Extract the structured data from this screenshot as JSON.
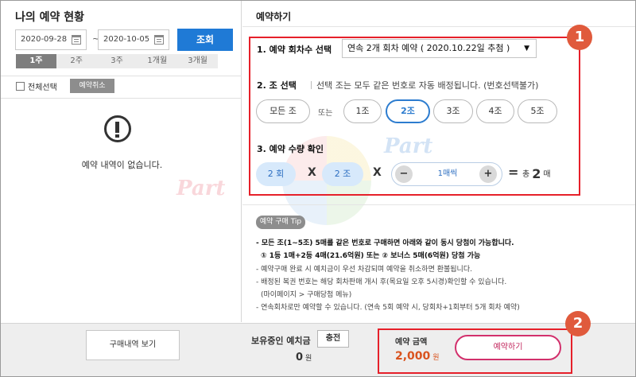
{
  "left_panel": {
    "title": "나의 예약 현황",
    "date_from": "2020-09-28",
    "date_to": "2020-10-05",
    "date_sep": "~",
    "query_btn": "조회",
    "period_tabs": [
      "1주",
      "2주",
      "3주",
      "1개월",
      "3개월"
    ],
    "active_period": "1주",
    "select_all": "전체선택",
    "cancel_btn": "예약취소",
    "empty_msg": "예약 내역이 없습니다."
  },
  "right_panel": {
    "title": "예약하기",
    "step1_label": "1. 예약 회차수 선택",
    "round_select_value": "연속 2개 회차 예약 ( 2020.10.22일 추첨 )",
    "step2_label": "2. 조 선택",
    "step2_desc": "선택 조는 모두 같은 번호로 자동 배정됩니다. (번호선택불가)",
    "all_jo": "모든 조",
    "or": "또는",
    "jo_options": [
      "1조",
      "2조",
      "3조",
      "4조",
      "5조"
    ],
    "selected_jo": "2조",
    "step3_label": "3. 예약 수량 확인",
    "rounds_pill": "2 회",
    "jo_pill": "2 조",
    "x_sign": "X",
    "minus": "−",
    "plus": "+",
    "per_qty": "1매씩",
    "equals": "=",
    "total_prefix": "총",
    "total_num": "2",
    "total_unit": "매"
  },
  "tip": {
    "tag": "예약 구매 Tip",
    "lines": [
      "- 모든 조(1~5조) 5매를 같은 번호로 구매하면 아래와 같이 동시 당첨이 가능합니다.",
      "① 1등 1매+2등 4매(21.6억원) 또는 ② 보너스 5매(6억원) 당첨 가능",
      "- 예약구매 완료 시 예치금이 우선 차감되며 예약을 취소하면 환불됩니다.",
      "- 배정된 복권 번호는 해당 회차판매 개시 후(목요일 오후 5시경)확인할 수 있습니다.",
      "(마이페이지 > 구매당첨 메뉴)",
      "- 연속회차로만 예약할 수 있습니다. (연속 5회 예약 시, 당회차+1회부터 5개 회차 예약)"
    ]
  },
  "bottom_bar": {
    "history_btn": "구매내역 보기",
    "deposit_label": "보유중인 예치금",
    "charge_btn": "충전",
    "deposit_value": "0",
    "deposit_unit": "원",
    "amount_label": "예약 금액",
    "amount_value": "2,000",
    "amount_unit": "원",
    "reserve_btn": "예약하기"
  },
  "annotations": {
    "badge1": "1",
    "badge2": "2"
  },
  "watermark": {
    "text": "Part"
  },
  "colors": {
    "accent_blue": "#1f7ad6",
    "highlight_red": "#e6202a",
    "badge_orange": "#e05a3c",
    "amount_orange": "#d9531e",
    "reserve_pink": "#d2306c"
  }
}
